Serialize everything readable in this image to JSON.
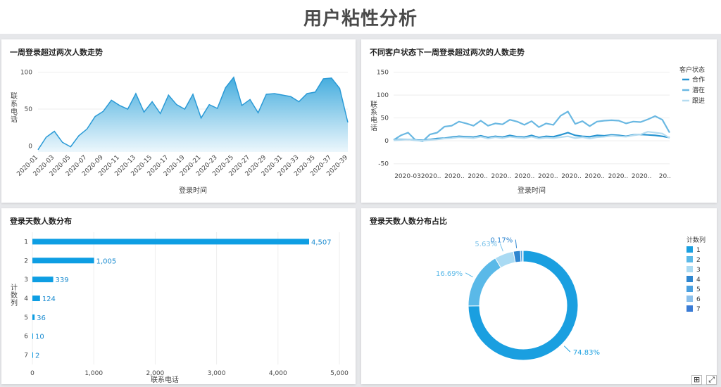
{
  "page": {
    "title": "用户粘性分析"
  },
  "colors": {
    "primary": "#1a9fe0",
    "area_top": "#3aa8dc",
    "area_bottom": "#eaf6fc",
    "line_hezuo": "#2694d1",
    "line_qianzai": "#6ab8e2",
    "line_genjin": "#b6dcf0",
    "bar": "#0e9ee3"
  },
  "panels": {
    "area": {
      "title": "一周登录超过两次人数走势"
    },
    "lines": {
      "title": "不同客户状态下一周登录超过两次的人数走势"
    },
    "bars": {
      "title": "登录天数人数分布"
    },
    "donut": {
      "title": "登录天数人数分布占比"
    }
  },
  "chart_data": [
    {
      "type": "area",
      "title": "一周登录超过两次人数走势",
      "xlabel": "登录时间",
      "ylabel": "联系电话",
      "ylim": [
        -8,
        110
      ],
      "yticks": [
        0,
        50,
        100
      ],
      "tick_labels": [
        "2020-01",
        "2020-03",
        "2020-05",
        "2020-07",
        "2020-09",
        "2020-11",
        "2020-13",
        "2020-15",
        "2020-17",
        "2020-19",
        "2020-21",
        "2020-23",
        "2020-25",
        "2020-27",
        "2020-29",
        "2020-31",
        "2020-33",
        "2020-35",
        "2020-37",
        "2020-39"
      ],
      "values": [
        -5,
        12,
        20,
        5,
        -1,
        14,
        23,
        40,
        47,
        62,
        55,
        50,
        71,
        46,
        60,
        44,
        69,
        56,
        50,
        70,
        38,
        56,
        51,
        79,
        93,
        55,
        63,
        45,
        70,
        71,
        69,
        67,
        60,
        71,
        73,
        91,
        92,
        78,
        32
      ]
    },
    {
      "type": "line",
      "title": "不同客户状态下一周登录超过两次的人数走势",
      "xlabel": "登录时间",
      "ylabel": "联系电话",
      "ylim": [
        -55,
        160
      ],
      "yticks": [
        -50,
        0,
        50,
        100,
        150
      ],
      "tick_labels": [
        "2020-03",
        "2020..",
        "2020..",
        "2020..",
        "2020..",
        "2020..",
        "2020..",
        "2020..",
        "2020..",
        "2020..",
        "2020..",
        "20.."
      ],
      "legend_title": "客户状态",
      "series": [
        {
          "name": "合作",
          "color": "#2694d1",
          "values": [
            2,
            3,
            3,
            2,
            1,
            3,
            5,
            6,
            8,
            10,
            9,
            8,
            11,
            7,
            10,
            8,
            12,
            9,
            8,
            12,
            7,
            10,
            9,
            13,
            18,
            12,
            10,
            9,
            12,
            11,
            13,
            12,
            10,
            13,
            14,
            13,
            12,
            10,
            7
          ]
        },
        {
          "name": "潜在",
          "color": "#6ab8e2",
          "values": [
            2,
            12,
            18,
            2,
            -1,
            14,
            18,
            31,
            33,
            42,
            38,
            33,
            44,
            33,
            38,
            36,
            46,
            42,
            35,
            43,
            30,
            38,
            35,
            55,
            64,
            37,
            43,
            32,
            42,
            44,
            45,
            44,
            38,
            42,
            41,
            47,
            54,
            46,
            18
          ]
        },
        {
          "name": "跟进",
          "color": "#b6dcf0",
          "values": [
            1,
            2,
            3,
            1,
            0,
            2,
            3,
            5,
            6,
            8,
            7,
            6,
            9,
            5,
            8,
            6,
            9,
            7,
            6,
            9,
            5,
            7,
            6,
            8,
            10,
            6,
            8,
            5,
            8,
            9,
            11,
            10,
            9,
            12,
            14,
            20,
            18,
            16,
            6
          ]
        }
      ]
    },
    {
      "type": "bar",
      "orientation": "horizontal",
      "title": "登录天数人数分布",
      "xlabel": "联系电话",
      "ylabel": "计数列",
      "xlim": [
        0,
        5000
      ],
      "xticks": [
        0,
        1000,
        2000,
        3000,
        4000,
        5000
      ],
      "xtick_labels": [
        "0",
        "1,000",
        "2,000",
        "3,000",
        "4,000",
        "5,000"
      ],
      "categories": [
        "1",
        "2",
        "3",
        "4",
        "5",
        "6",
        "7"
      ],
      "values": [
        4507,
        1005,
        339,
        124,
        36,
        10,
        2
      ],
      "value_labels": [
        "4,507",
        "1,005",
        "339",
        "124",
        "36",
        "10",
        "2"
      ]
    },
    {
      "type": "pie",
      "variant": "donut",
      "title": "登录天数人数分布占比",
      "legend_title": "计数列",
      "categories": [
        "1",
        "2",
        "3",
        "4",
        "5",
        "6",
        "7"
      ],
      "values": [
        4507,
        1005,
        339,
        124,
        36,
        10,
        2
      ],
      "colors": [
        "#1a9fe0",
        "#5ab9e8",
        "#a9daf3",
        "#2e86d0",
        "#4aa0e0",
        "#8bc0ec",
        "#3a7bd5"
      ],
      "labels": [
        {
          "category": "1",
          "text": "74.83%"
        },
        {
          "category": "2",
          "text": "16.69%"
        },
        {
          "category": "3",
          "text": "5.63%"
        },
        {
          "category": "4",
          "text": "0.17%"
        }
      ]
    }
  ],
  "corner": {
    "icon_a": "⊞",
    "icon_b": "⤢"
  }
}
